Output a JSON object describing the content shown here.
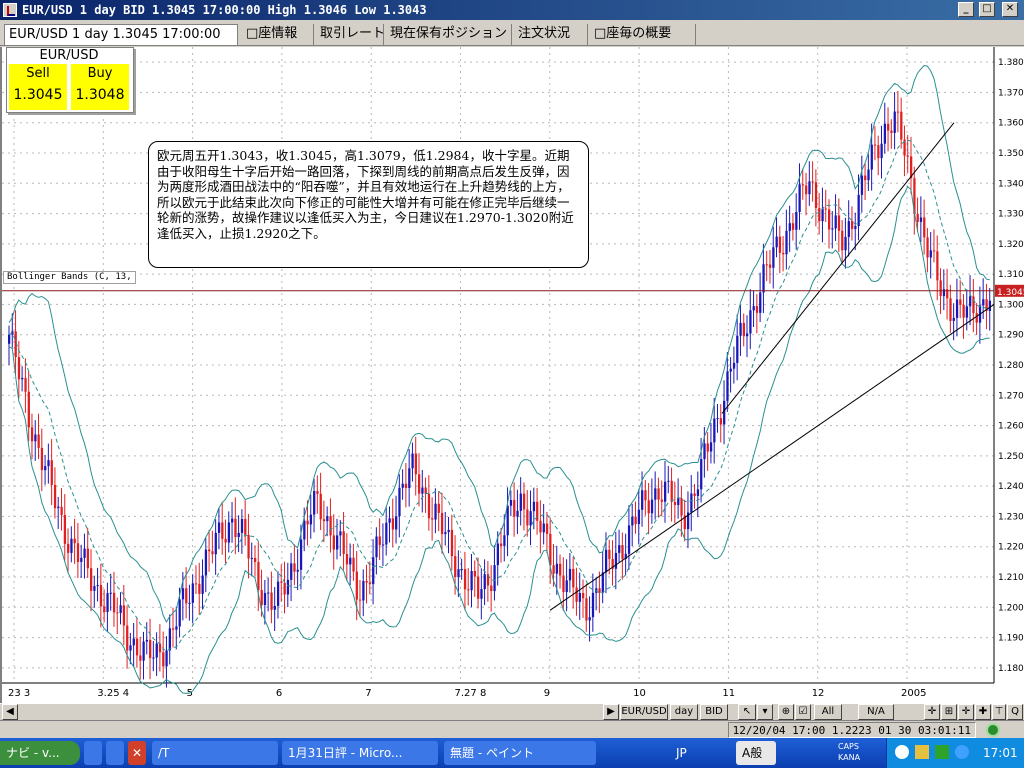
{
  "window": {
    "title": "EUR/USD 1 day BID 1.3045 17:00:00 High 1.3046 Low 1.3043",
    "minimize": "_",
    "maximize": "□",
    "close": "✕"
  },
  "tabs": [
    {
      "label": "EUR/USD 1 day 1.3045 17:00:00",
      "active": true
    },
    {
      "label": "□座情報",
      "active": false
    },
    {
      "label": "取引レート",
      "active": false
    },
    {
      "label": "現在保有ポジション",
      "active": false
    },
    {
      "label": "注文状況",
      "active": false
    },
    {
      "label": "□座毎の概要",
      "active": false
    }
  ],
  "quote": {
    "symbol": "EUR/USD",
    "sell_label": "Sell",
    "sell_value": "1.3045",
    "buy_label": "Buy",
    "buy_value": "1.3048"
  },
  "comment": "欧元周五开1.3043，收1.3045，高1.3079，低1.2984，收十字星。近期由于收阳母生十字后开始一路回落，下探到周线的前期高点后发生反弹，因为两度形成酒田战法中的“阳吞噬”，并且有效地运行在上升趋势线的上方，所以欧元于此结束此次向下修正的可能性大增并有可能在修正完毕后继续一轮新的涨势，故操作建议以逢低买入为主，今日建议在1.2970-1.3020附近逢低买入，止损1.2920之下。",
  "indicator_label": "Bollinger Bands (C, 13,",
  "chart_data": {
    "type": "candlestick",
    "instrument": "EUR/USD",
    "timeframe": "1 day",
    "current_price": 1.3045,
    "current_price_label": "1.3045",
    "ylim": [
      1.175,
      1.385
    ],
    "y_ticks": [
      1.38,
      1.37,
      1.36,
      1.35,
      1.34,
      1.33,
      1.32,
      1.31,
      1.3,
      1.29,
      1.28,
      1.27,
      1.26,
      1.25,
      1.24,
      1.23,
      1.22,
      1.21,
      1.2,
      1.19,
      1.18
    ],
    "y_tick_labels": [
      "1.3800",
      "1.3700",
      "1.3600",
      "1.3500",
      "1.3400",
      "1.3300",
      "1.3200",
      "1.3100",
      "1.3000",
      "1.2900",
      "1.2800",
      "1.2700",
      "1.2600",
      "1.2500",
      "1.2400",
      "1.2300",
      "1.2200",
      "1.2100",
      "1.2000",
      "1.1900",
      "1.1800"
    ],
    "x_tick_labels": [
      "23 3",
      "3.25 4",
      "5",
      "6",
      "7",
      "7.27 8",
      "9",
      "10",
      "11",
      "12",
      "2005"
    ],
    "close_path": [
      1.29,
      1.275,
      1.262,
      1.25,
      1.238,
      1.228,
      1.22,
      1.213,
      1.208,
      1.203,
      1.198,
      1.192,
      1.187,
      1.183,
      1.185,
      1.19,
      1.198,
      1.205,
      1.212,
      1.218,
      1.225,
      1.23,
      1.222,
      1.212,
      1.205,
      1.2,
      1.208,
      1.218,
      1.228,
      1.235,
      1.228,
      1.22,
      1.212,
      1.206,
      1.212,
      1.222,
      1.232,
      1.24,
      1.245,
      1.238,
      1.23,
      1.222,
      1.215,
      1.208,
      1.204,
      1.21,
      1.22,
      1.23,
      1.236,
      1.232,
      1.224,
      1.216,
      1.21,
      1.204,
      1.2,
      1.205,
      1.212,
      1.218,
      1.224,
      1.23,
      1.236,
      1.24,
      1.236,
      1.23,
      1.236,
      1.245,
      1.258,
      1.27,
      1.282,
      1.292,
      1.302,
      1.31,
      1.318,
      1.325,
      1.332,
      1.34,
      1.334,
      1.326,
      1.32,
      1.328,
      1.338,
      1.348,
      1.358,
      1.362,
      1.35,
      1.335,
      1.32,
      1.308,
      1.302,
      1.298,
      1.296,
      1.3,
      1.304
    ],
    "bollinger_bands": {
      "period": 13
    }
  },
  "toolbar": {
    "symbol": "EUR/USD",
    "period": "day",
    "side": "BID",
    "range_all": "All",
    "range_na": "N/A"
  },
  "status": {
    "readout": "12/20/04 17:00  1.2223 01 30 03:01:11"
  },
  "taskbar": {
    "start": "ナビ - v...",
    "tasks": [
      "/T",
      "1月31日評 - Micro...",
      "無題 - ペイント"
    ],
    "lang": "JP",
    "ime": "A般",
    "caps": "CAPS",
    "kana": "KANA",
    "clock": "17:01"
  },
  "colors": {
    "up_candle": "#1818b8",
    "down_candle": "#e02020",
    "band": "#2a9090",
    "price_line": "#8b1a1a",
    "price_tag": "#c82020",
    "highlight": "#ffff00",
    "taskbar": "#1f5fd6"
  }
}
